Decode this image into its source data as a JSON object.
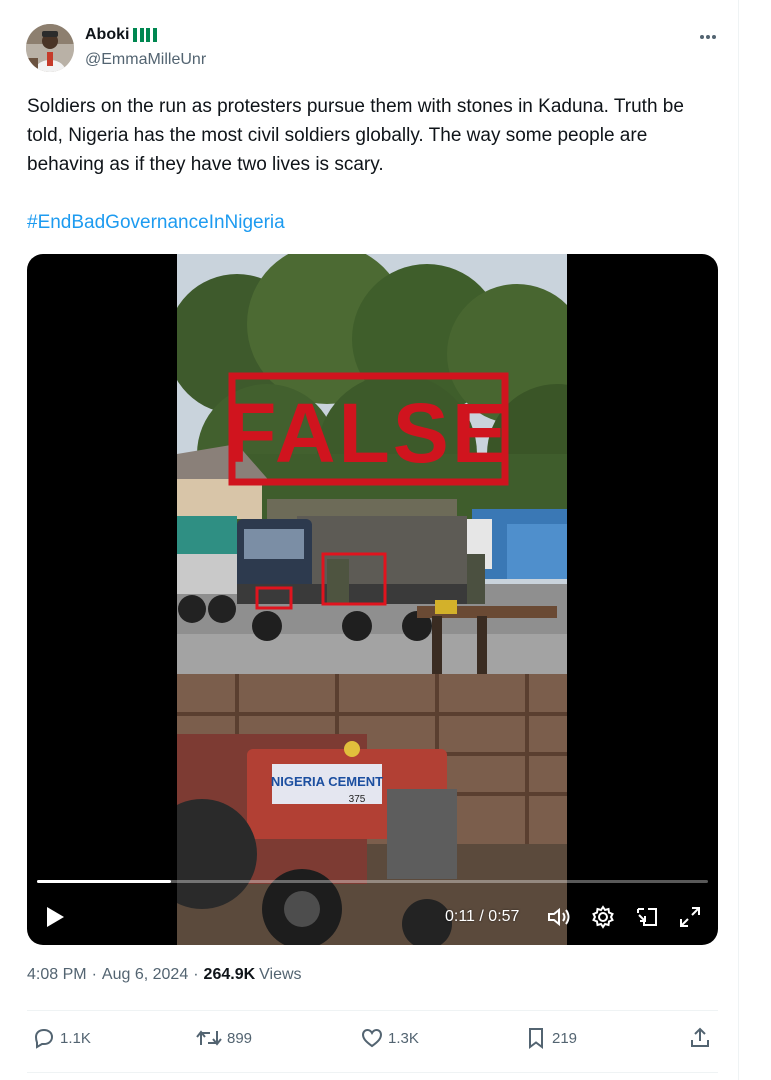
{
  "author": {
    "display_name": "Aboki",
    "handle": "@EmmaMilleUnr",
    "flag_count": 2,
    "avatar_icon": "avatar-photo"
  },
  "tweet": {
    "text": "Soldiers on the run as protesters pursue them with stones in Kaduna. Truth be told, Nigeria has the most civil soldiers globally. The way some people are behaving as if they have two lives is scary.",
    "hashtag": "#EndBadGovernanceInNigeria"
  },
  "media": {
    "overlay_stamp": "FALSE",
    "tractor_label": "NIGERIA CEMENT",
    "tractor_model": "375",
    "video_time": "0:11 / 0:57",
    "progress": 0.2,
    "stamp_color": "#d0141e"
  },
  "meta": {
    "time": "4:08 PM",
    "date": "Aug 6, 2024",
    "views_count": "264.9K",
    "views_label": "Views"
  },
  "actions": {
    "replies": "1.1K",
    "reposts": "899",
    "likes": "1.3K",
    "bookmarks": "219"
  },
  "colors": {
    "link": "#1d9bf0",
    "secondary_text": "#536471",
    "flag_green": "#008751"
  }
}
